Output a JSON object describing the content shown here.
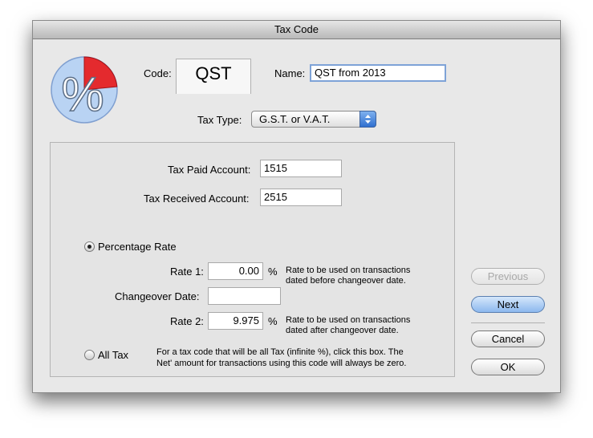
{
  "window": {
    "title": "Tax Code"
  },
  "header": {
    "code_label": "Code:",
    "code_value": "QST",
    "name_label": "Name:",
    "name_value": "QST from 2013",
    "tax_type_label": "Tax Type:",
    "tax_type_value": "G.S.T. or V.A.T."
  },
  "accounts": {
    "tax_paid_label": "Tax Paid Account:",
    "tax_paid_value": "1515",
    "tax_received_label": "Tax Received Account:",
    "tax_received_value": "2515"
  },
  "percentage": {
    "option_label": "Percentage Rate",
    "selected": true,
    "rate1_label": "Rate 1:",
    "rate1_value": "0.00",
    "rate1_unit": "%",
    "rate1_note_line1": "Rate to be used on transactions",
    "rate1_note_line2": "dated before changeover date.",
    "changeover_label": "Changeover Date:",
    "changeover_value": "",
    "rate2_label": "Rate 2:",
    "rate2_value": "9.975",
    "rate2_unit": "%",
    "rate2_note_line1": "Rate to be used on transactions",
    "rate2_note_line2": "dated after changeover date."
  },
  "all_tax": {
    "option_label": "All Tax",
    "note_line1": "For a tax code that will be all Tax (infinite %), click this box. The",
    "note_line2": "Net' amount for transactions using this code will always be zero."
  },
  "buttons": {
    "previous": "Previous",
    "next": "Next",
    "cancel": "Cancel",
    "ok": "OK"
  },
  "icon": {
    "name": "percent-pie-icon",
    "pie_color": "#b9d3f3",
    "slice_color": "#e0252b"
  }
}
